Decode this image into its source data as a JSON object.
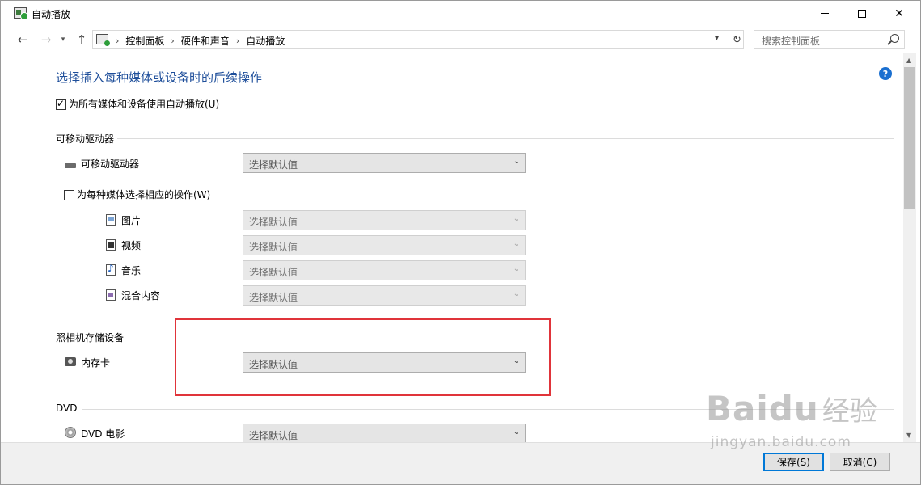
{
  "window": {
    "title": "自动播放",
    "controls": [
      "minimize",
      "maximize",
      "close"
    ]
  },
  "nav": {
    "back_icon": "arrow-left-icon",
    "forward_icon": "arrow-right-icon",
    "up_icon": "arrow-up-icon",
    "breadcrumbs": [
      "控制面板",
      "硬件和声音",
      "自动播放"
    ],
    "search_placeholder": "搜索控制面板"
  },
  "main": {
    "heading": "选择插入每种媒体或设备时的后续操作",
    "use_autoplay_label": "为所有媒体和设备使用自动播放(U)",
    "use_autoplay_checked": true,
    "sections": {
      "removable": {
        "header": "可移动驱动器",
        "drive_label": "可移动驱动器",
        "drive_value": "选择默认值",
        "per_media_label": "为每种媒体选择相应的操作(W)",
        "per_media_checked": false,
        "media": [
          {
            "label": "图片",
            "value": "选择默认值",
            "icon": "picture-icon"
          },
          {
            "label": "视频",
            "value": "选择默认值",
            "icon": "video-icon"
          },
          {
            "label": "音乐",
            "value": "选择默认值",
            "icon": "music-icon"
          },
          {
            "label": "混合内容",
            "value": "选择默认值",
            "icon": "mixed-content-icon"
          }
        ]
      },
      "camera": {
        "header": "照相机存储设备",
        "card_label": "内存卡",
        "card_value": "选择默认值"
      },
      "dvd": {
        "header": "DVD",
        "movie_label": "DVD 电影",
        "movie_value": "选择默认值"
      }
    }
  },
  "footer": {
    "save_label": "保存(S)",
    "cancel_label": "取消(C)"
  },
  "watermark": {
    "logo": "Bai",
    "logo_tail": "du",
    "cn": "经验",
    "url": "jingyan.baidu.com"
  },
  "colors": {
    "heading": "#1e4e9a",
    "highlight": "#e0343a",
    "accent": "#0078d7"
  }
}
